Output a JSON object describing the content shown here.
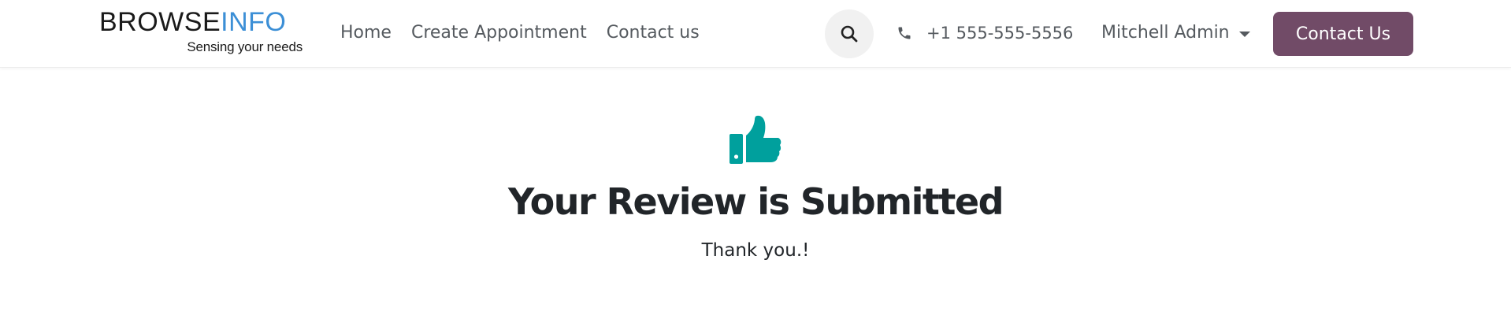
{
  "brand": {
    "logo_part1": "BROWSE",
    "logo_part2": "INFO",
    "tagline": "Sensing your needs",
    "accent": "#3c8fd6"
  },
  "nav": {
    "items": [
      {
        "label": "Home"
      },
      {
        "label": "Create Appointment"
      },
      {
        "label": "Contact us"
      }
    ]
  },
  "header": {
    "search_icon": "search-icon",
    "phone_icon": "phone-icon",
    "phone": "+1 555-555-5556",
    "user": "Mitchell Admin",
    "cta_label": "Contact Us",
    "cta_color": "#714b67"
  },
  "main": {
    "icon": "thumbs-up-icon",
    "icon_color": "#00a09d",
    "title": "Your Review is Submitted",
    "message": "Thank you.!"
  }
}
